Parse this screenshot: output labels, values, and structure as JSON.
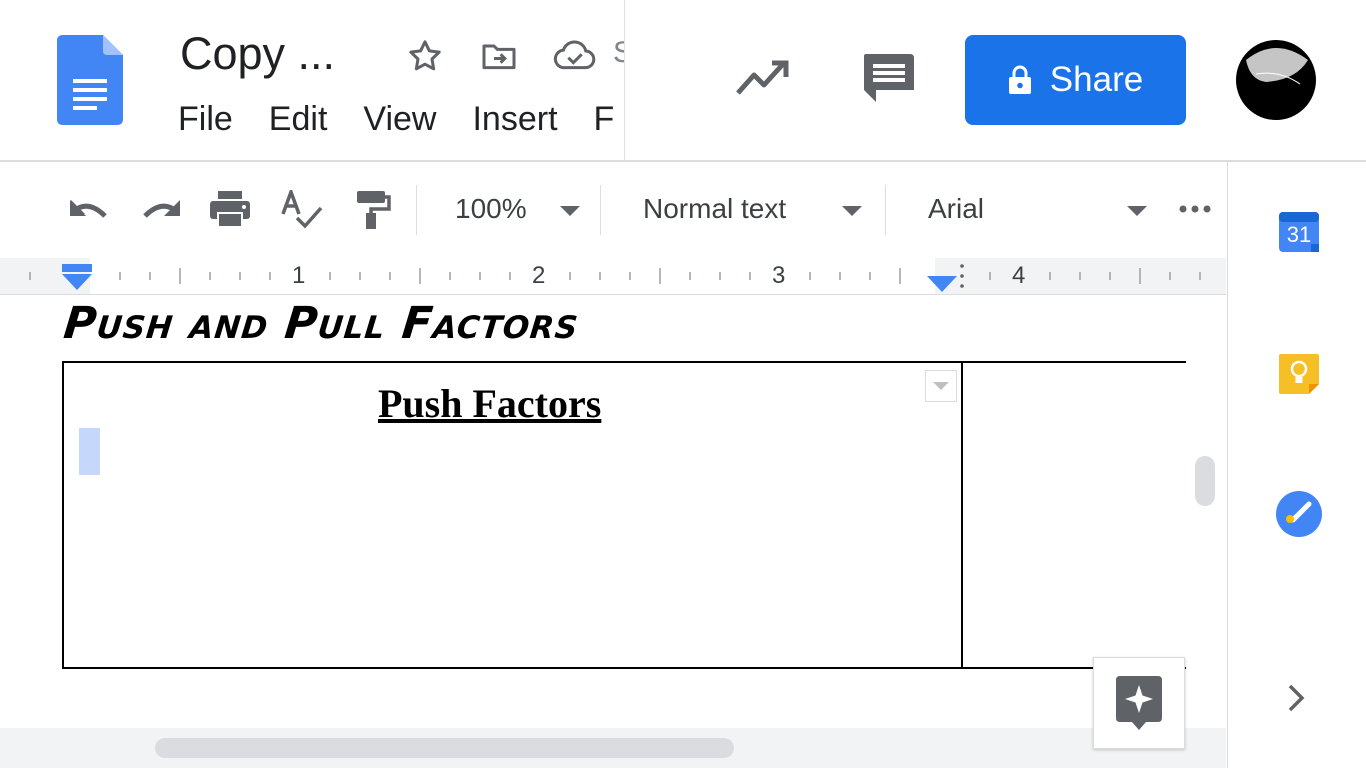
{
  "header": {
    "doc_title": "Copy ...",
    "saving_peek": "S",
    "menu": [
      "File",
      "Edit",
      "View",
      "Insert",
      "F"
    ],
    "share_label": "Share"
  },
  "toolbar": {
    "zoom": "100%",
    "style": "Normal text",
    "font": "Arial"
  },
  "ruler": {
    "numbers": [
      "1",
      "2",
      "3",
      "4"
    ]
  },
  "document": {
    "heading": "Push and Pull Factors",
    "table_cell_title": "Push Factors"
  },
  "side_panel": {
    "calendar_day": "31"
  },
  "colors": {
    "share_blue": "#1a73e8",
    "docs_blue": "#4285f4",
    "keep_yellow": "#f6bf26",
    "tasks_blue": "#4285f4"
  },
  "icons": [
    "docs-logo-icon",
    "star-icon",
    "move-folder-icon",
    "cloud-saved-icon",
    "activity-trend-icon",
    "comment-icon",
    "lock-icon",
    "undo-icon",
    "redo-icon",
    "print-icon",
    "spellcheck-icon",
    "paint-format-icon",
    "more-icon",
    "calendar-icon",
    "keep-icon",
    "tasks-icon",
    "chevron-right-icon",
    "explore-icon"
  ]
}
